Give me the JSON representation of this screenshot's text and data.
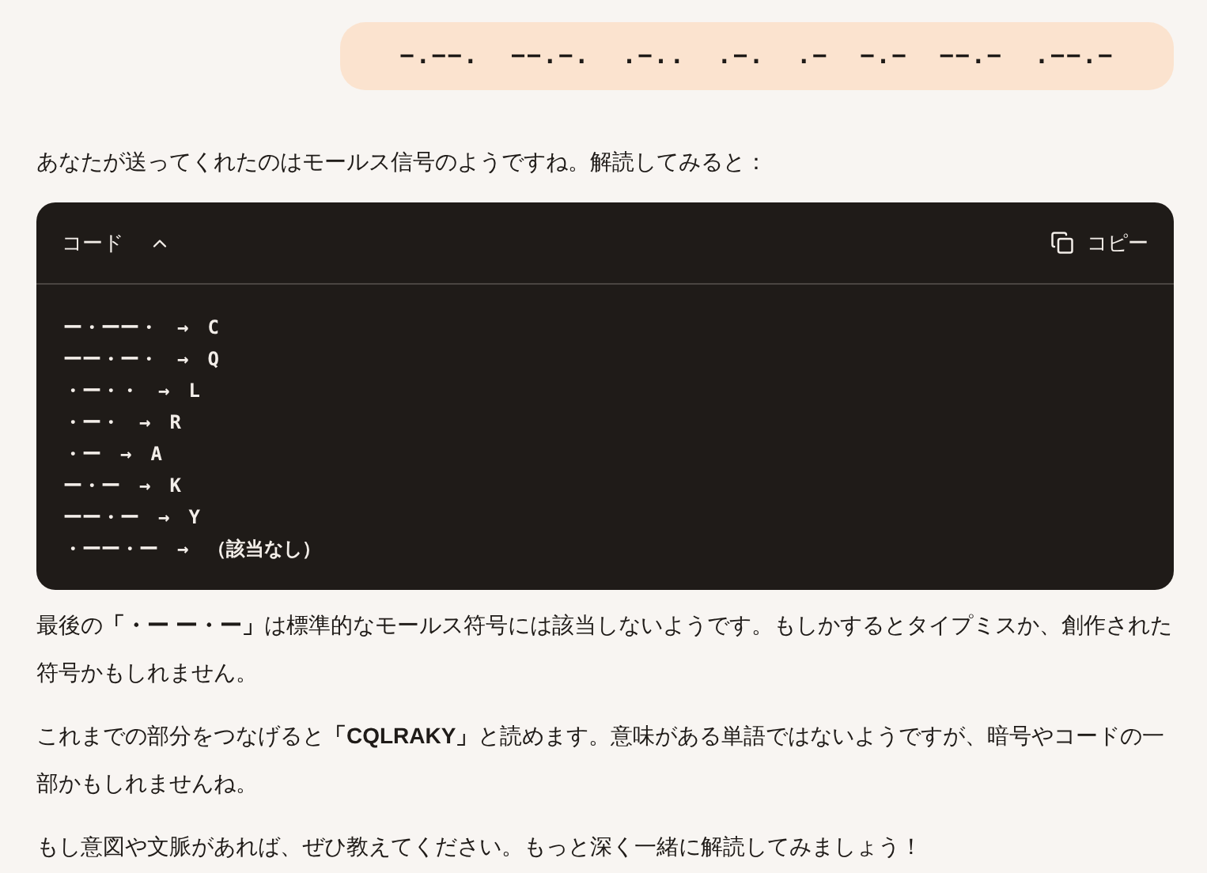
{
  "user_message": "−.−−.  −−.−.  .−..  .−.  .−  −.−  −−.−  .−−.−",
  "intro": "あなたが送ってくれたのはモールス信号のようですね。解読してみると：",
  "code_block": {
    "label": "コード",
    "copy_label": "コピー",
    "expanded": true,
    "lines": [
      "ー・ーー・　→　C",
      "ーー・ー・　→　Q",
      "・ー・・　→　L",
      "・ー・　→　R",
      "・ー　→　A",
      "ー・ー　→　K",
      "ーー・ー　→　Y",
      "・ーー・ー　→　（該当なし）"
    ]
  },
  "paragraphs": [
    "最後の**「・ー ー・ー」**は標準的なモールス符号には該当しないようです。もしかするとタイプミスか、創作された符号かもしれません。",
    "これまでの部分をつなげると**「CQLRAKY」**と読めます。意味がある単語ではないようですが、暗号やコードの一部かもしれませんね。",
    "もし意図や文脈があれば、ぜひ教えてください。もっと深く一緒に解読してみましょう！"
  ]
}
